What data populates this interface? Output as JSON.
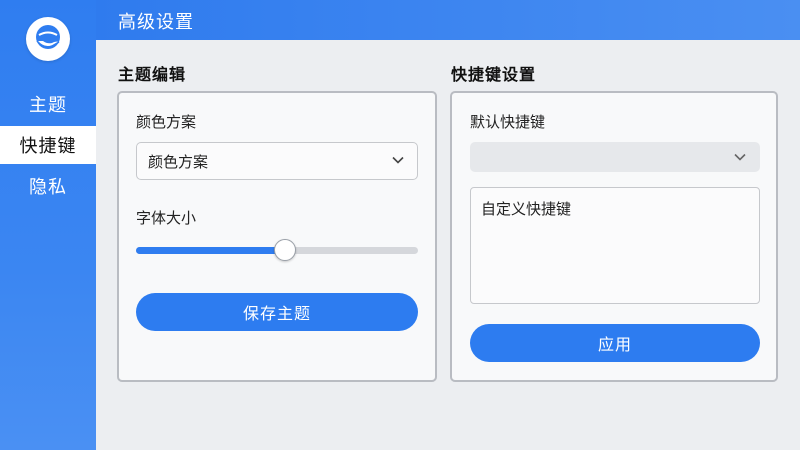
{
  "sidebar": {
    "logo_icon": "hand-globe-logo",
    "items": [
      {
        "label": "主题",
        "active": false
      },
      {
        "label": "快捷键",
        "active": true
      },
      {
        "label": "隐私",
        "active": false
      }
    ]
  },
  "header": {
    "title": "高级设置"
  },
  "theme_editor": {
    "section_title": "主题编辑",
    "color_scheme_label": "颜色方案",
    "color_scheme_value": "颜色方案",
    "font_size_label": "字体大小",
    "font_size_level": 0.53,
    "save_button": "保存主题"
  },
  "shortcut_settings": {
    "section_title": "快捷键设置",
    "default_label": "默认快捷键",
    "default_value": "",
    "custom_value": "自定义快捷键",
    "apply_button": "应用"
  },
  "colors": {
    "accent": "#2f7df0",
    "sidebar": "#3b86f2",
    "background": "#eceef1"
  }
}
